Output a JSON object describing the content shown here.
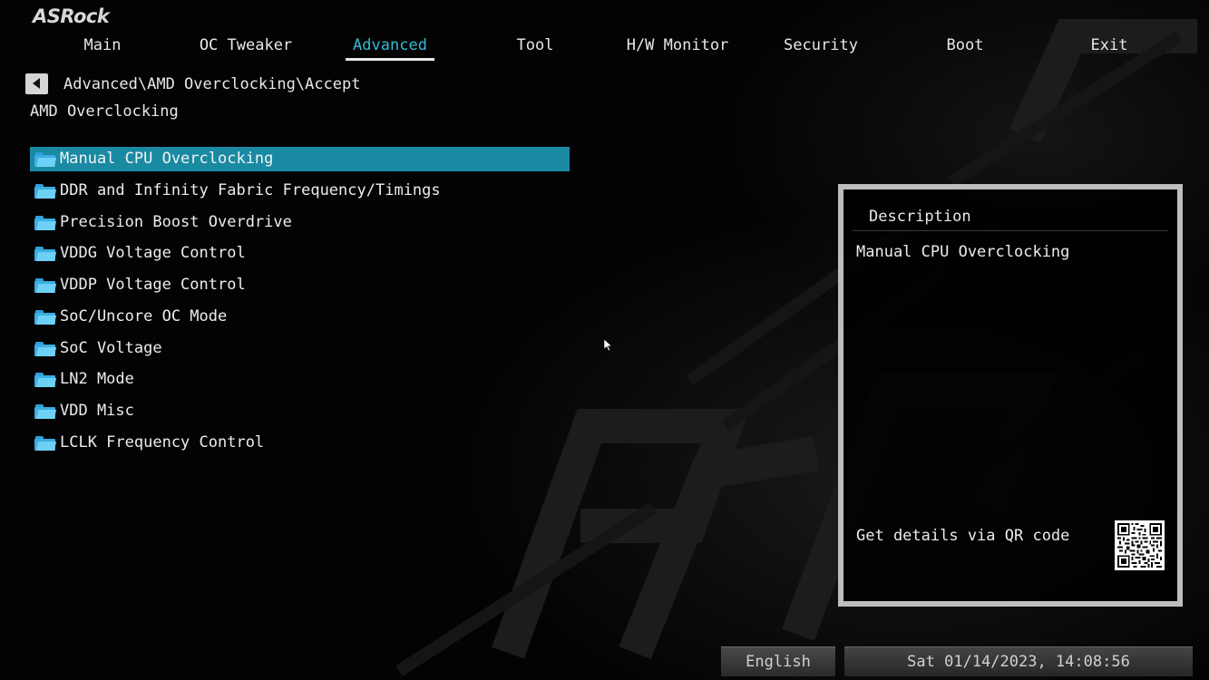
{
  "brand": {
    "logo_text": "ASRock"
  },
  "tabs": [
    {
      "label": "Main"
    },
    {
      "label": "OC Tweaker"
    },
    {
      "label": "Advanced",
      "active": true
    },
    {
      "label": "Tool"
    },
    {
      "label": "H/W Monitor"
    },
    {
      "label": "Security"
    },
    {
      "label": "Boot"
    },
    {
      "label": "Exit"
    }
  ],
  "breadcrumb": "Advanced\\AMD Overclocking\\Accept",
  "section_title": "AMD Overclocking",
  "menu": {
    "items": [
      {
        "label": "Manual CPU Overclocking",
        "icon": "folder-icon",
        "selected": true
      },
      {
        "label": "DDR and Infinity Fabric Frequency/Timings",
        "icon": "folder-icon"
      },
      {
        "label": "Precision Boost Overdrive",
        "icon": "folder-icon"
      },
      {
        "label": "VDDG Voltage Control",
        "icon": "folder-icon"
      },
      {
        "label": "VDDP Voltage Control",
        "icon": "folder-icon"
      },
      {
        "label": "SoC/Uncore OC Mode",
        "icon": "folder-icon"
      },
      {
        "label": "SoC Voltage",
        "icon": "folder-icon"
      },
      {
        "label": "LN2 Mode",
        "icon": "folder-icon"
      },
      {
        "label": "VDD Misc",
        "icon": "folder-icon"
      },
      {
        "label": "LCLK Frequency Control",
        "icon": "folder-icon"
      }
    ]
  },
  "description": {
    "title": "Description",
    "text": "Manual CPU Overclocking",
    "qr_label": "Get details via QR code"
  },
  "status_bar": {
    "language": "English",
    "datetime": "Sat 01/14/2023, 14:08:56"
  },
  "colors": {
    "accent": "#37b9d6",
    "selection": "#1a8aa3",
    "folder": "#3aaee3",
    "panel_border": "#bdbdbd"
  }
}
